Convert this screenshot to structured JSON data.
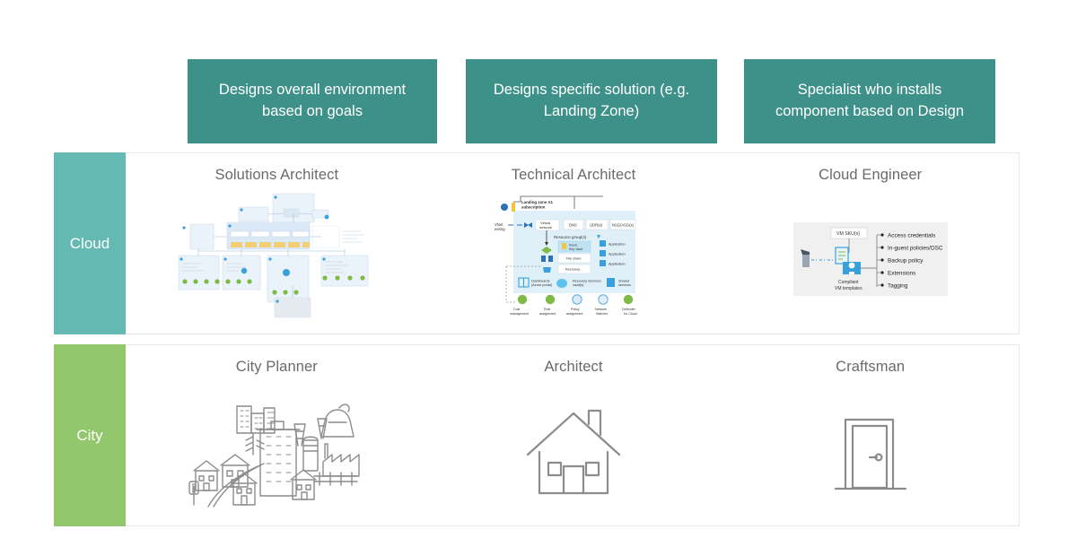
{
  "headers": [
    {
      "label": "Designs overall environment based on goals"
    },
    {
      "label": "Designs specific solution (e.g. Landing Zone)"
    },
    {
      "label": "Specialist who installs component based on Design"
    }
  ],
  "colors": {
    "header_box": "#3e9188",
    "cloud_label": "#64b9b2",
    "city_label": "#92c76e",
    "row_border": "#e8e8e8",
    "title_text": "#6a6a6a",
    "line_art": "#8c8c8c"
  },
  "rows": [
    {
      "label": "Cloud",
      "cells": [
        {
          "title": "Solutions Architect",
          "art": "azure-enterprise-scale-architecture-diagram"
        },
        {
          "title": "Technical Architect",
          "art": "azure-landing-zone-diagram"
        },
        {
          "title": "Cloud Engineer",
          "art": "azure-compliant-vm-diagram"
        }
      ]
    },
    {
      "label": "City",
      "cells": [
        {
          "title": "City Planner",
          "art": "city-skyline-line-art"
        },
        {
          "title": "Architect",
          "art": "house-line-icon"
        },
        {
          "title": "Craftsman",
          "art": "door-line-icon"
        }
      ]
    }
  ],
  "diagram_landing_zone": {
    "title": "Landing zone A1 subscription",
    "vnet_peering": "VNet peering",
    "virtual_network": "Virtual network",
    "top_boxes": [
      "DNS",
      "UDR(s)",
      "NSG/ASG(s)"
    ],
    "resource_groups": "Resource group(s)",
    "resource_items": [
      "Azure Key Vault",
      "File share",
      "Recovery..."
    ],
    "applications": [
      "Application",
      "Application",
      "Application"
    ],
    "services": [
      "Dashboards (Azure portal)",
      "Recovery Services vault(s)",
      "Shared services"
    ],
    "footer": [
      "Cost management",
      "Role assignment",
      "Policy assignment",
      "Network Watcher",
      "Defender for Cloud"
    ]
  },
  "diagram_vm": {
    "sku_label": "VM SKU(s)",
    "template_label": "Compliant VM templates",
    "bullets": [
      "Access credentials",
      "In-guest policies/DSC",
      "Backup policy",
      "Extensions",
      "Tagging"
    ]
  }
}
